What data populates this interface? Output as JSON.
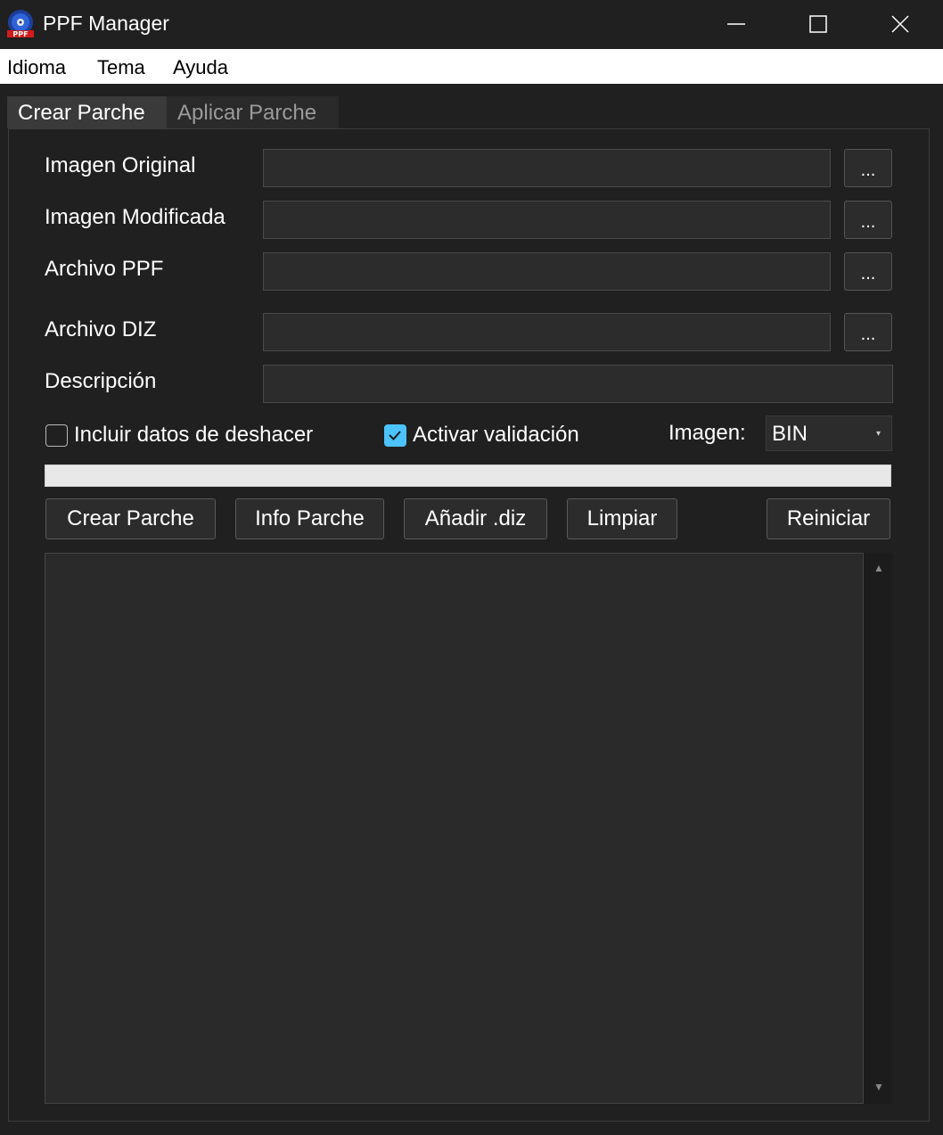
{
  "window": {
    "title": "PPF Manager",
    "icon": "ppf-disc-icon",
    "controls": [
      "minimize-icon",
      "maximize-icon",
      "close-icon"
    ]
  },
  "menu": {
    "items": [
      {
        "label": "Idioma"
      },
      {
        "label": "Tema"
      },
      {
        "label": "Ayuda"
      }
    ]
  },
  "tabs": [
    {
      "label": "Crear Parche",
      "active": true
    },
    {
      "label": "Aplicar Parche",
      "active": false
    }
  ],
  "form": {
    "original_image_label": "Imagen Original",
    "original_image_value": "",
    "modified_image_label": "Imagen Modificada",
    "modified_image_value": "",
    "ppf_file_label": "Archivo PPF",
    "ppf_file_value": "",
    "diz_file_label": "Archivo DIZ",
    "diz_file_value": "",
    "description_label": "Descripción",
    "description_value": "",
    "browse_label": "..."
  },
  "options": {
    "undo_label": "Incluir datos de deshacer",
    "undo_checked": false,
    "validation_label": "Activar validación",
    "validation_checked": true,
    "image_type_label": "Imagen:",
    "image_type_value": "BIN"
  },
  "progress": {
    "value": 0
  },
  "actions": {
    "create_patch": "Crear Parche",
    "patch_info": "Info Parche",
    "add_diz": "Añadir .diz",
    "clear": "Limpiar",
    "reset": "Reiniciar"
  },
  "log": {
    "text": ""
  },
  "colors": {
    "background": "#202020",
    "field": "#2c2c2c",
    "accent": "#4cc2ff",
    "menubar": "#ffffff"
  }
}
